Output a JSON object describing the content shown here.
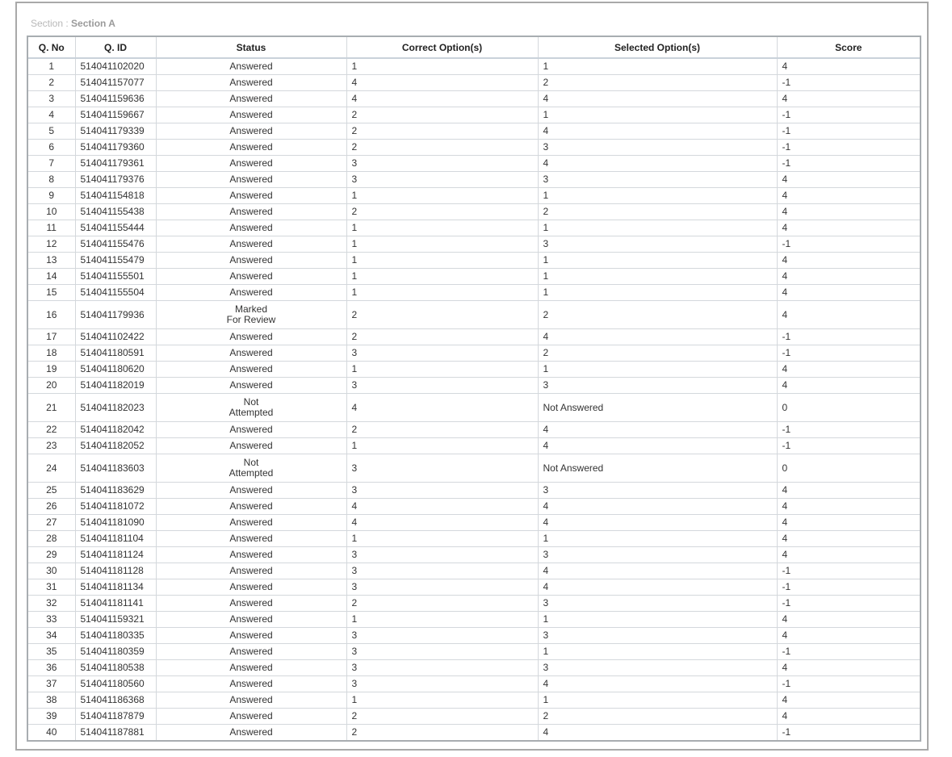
{
  "section": {
    "prefix": "Section : ",
    "name": "Section A"
  },
  "columns": [
    "Q. No",
    "Q. ID",
    "Status",
    "Correct Option(s)",
    "Selected Option(s)",
    "Score"
  ],
  "rows": [
    {
      "no": "1",
      "id": "514041102020",
      "status": [
        "Answered"
      ],
      "correct": "1",
      "selected": "1",
      "score": "4"
    },
    {
      "no": "2",
      "id": "514041157077",
      "status": [
        "Answered"
      ],
      "correct": "4",
      "selected": "2",
      "score": "-1"
    },
    {
      "no": "3",
      "id": "514041159636",
      "status": [
        "Answered"
      ],
      "correct": "4",
      "selected": "4",
      "score": "4"
    },
    {
      "no": "4",
      "id": "514041159667",
      "status": [
        "Answered"
      ],
      "correct": "2",
      "selected": "1",
      "score": "-1"
    },
    {
      "no": "5",
      "id": "514041179339",
      "status": [
        "Answered"
      ],
      "correct": "2",
      "selected": "4",
      "score": "-1"
    },
    {
      "no": "6",
      "id": "514041179360",
      "status": [
        "Answered"
      ],
      "correct": "2",
      "selected": "3",
      "score": "-1"
    },
    {
      "no": "7",
      "id": "514041179361",
      "status": [
        "Answered"
      ],
      "correct": "3",
      "selected": "4",
      "score": "-1"
    },
    {
      "no": "8",
      "id": "514041179376",
      "status": [
        "Answered"
      ],
      "correct": "3",
      "selected": "3",
      "score": "4"
    },
    {
      "no": "9",
      "id": "514041154818",
      "status": [
        "Answered"
      ],
      "correct": "1",
      "selected": "1",
      "score": "4"
    },
    {
      "no": "10",
      "id": "514041155438",
      "status": [
        "Answered"
      ],
      "correct": "2",
      "selected": "2",
      "score": "4"
    },
    {
      "no": "11",
      "id": "514041155444",
      "status": [
        "Answered"
      ],
      "correct": "1",
      "selected": "1",
      "score": "4"
    },
    {
      "no": "12",
      "id": "514041155476",
      "status": [
        "Answered"
      ],
      "correct": "1",
      "selected": "3",
      "score": "-1"
    },
    {
      "no": "13",
      "id": "514041155479",
      "status": [
        "Answered"
      ],
      "correct": "1",
      "selected": "1",
      "score": "4"
    },
    {
      "no": "14",
      "id": "514041155501",
      "status": [
        "Answered"
      ],
      "correct": "1",
      "selected": "1",
      "score": "4"
    },
    {
      "no": "15",
      "id": "514041155504",
      "status": [
        "Answered"
      ],
      "correct": "1",
      "selected": "1",
      "score": "4"
    },
    {
      "no": "16",
      "id": "514041179936",
      "status": [
        "Marked",
        "For Review"
      ],
      "correct": "2",
      "selected": "2",
      "score": "4"
    },
    {
      "no": "17",
      "id": "514041102422",
      "status": [
        "Answered"
      ],
      "correct": "2",
      "selected": "4",
      "score": "-1"
    },
    {
      "no": "18",
      "id": "514041180591",
      "status": [
        "Answered"
      ],
      "correct": "3",
      "selected": "2",
      "score": "-1"
    },
    {
      "no": "19",
      "id": "514041180620",
      "status": [
        "Answered"
      ],
      "correct": "1",
      "selected": "1",
      "score": "4"
    },
    {
      "no": "20",
      "id": "514041182019",
      "status": [
        "Answered"
      ],
      "correct": "3",
      "selected": "3",
      "score": "4"
    },
    {
      "no": "21",
      "id": "514041182023",
      "status": [
        "Not",
        "Attempted"
      ],
      "correct": "4",
      "selected": "Not Answered",
      "score": "0"
    },
    {
      "no": "22",
      "id": "514041182042",
      "status": [
        "Answered"
      ],
      "correct": "2",
      "selected": "4",
      "score": "-1"
    },
    {
      "no": "23",
      "id": "514041182052",
      "status": [
        "Answered"
      ],
      "correct": "1",
      "selected": "4",
      "score": "-1"
    },
    {
      "no": "24",
      "id": "514041183603",
      "status": [
        "Not",
        "Attempted"
      ],
      "correct": "3",
      "selected": "Not Answered",
      "score": "0"
    },
    {
      "no": "25",
      "id": "514041183629",
      "status": [
        "Answered"
      ],
      "correct": "3",
      "selected": "3",
      "score": "4"
    },
    {
      "no": "26",
      "id": "514041181072",
      "status": [
        "Answered"
      ],
      "correct": "4",
      "selected": "4",
      "score": "4"
    },
    {
      "no": "27",
      "id": "514041181090",
      "status": [
        "Answered"
      ],
      "correct": "4",
      "selected": "4",
      "score": "4"
    },
    {
      "no": "28",
      "id": "514041181104",
      "status": [
        "Answered"
      ],
      "correct": "1",
      "selected": "1",
      "score": "4"
    },
    {
      "no": "29",
      "id": "514041181124",
      "status": [
        "Answered"
      ],
      "correct": "3",
      "selected": "3",
      "score": "4"
    },
    {
      "no": "30",
      "id": "514041181128",
      "status": [
        "Answered"
      ],
      "correct": "3",
      "selected": "4",
      "score": "-1"
    },
    {
      "no": "31",
      "id": "514041181134",
      "status": [
        "Answered"
      ],
      "correct": "3",
      "selected": "4",
      "score": "-1"
    },
    {
      "no": "32",
      "id": "514041181141",
      "status": [
        "Answered"
      ],
      "correct": "2",
      "selected": "3",
      "score": "-1"
    },
    {
      "no": "33",
      "id": "514041159321",
      "status": [
        "Answered"
      ],
      "correct": "1",
      "selected": "1",
      "score": "4"
    },
    {
      "no": "34",
      "id": "514041180335",
      "status": [
        "Answered"
      ],
      "correct": "3",
      "selected": "3",
      "score": "4"
    },
    {
      "no": "35",
      "id": "514041180359",
      "status": [
        "Answered"
      ],
      "correct": "3",
      "selected": "1",
      "score": "-1"
    },
    {
      "no": "36",
      "id": "514041180538",
      "status": [
        "Answered"
      ],
      "correct": "3",
      "selected": "3",
      "score": "4"
    },
    {
      "no": "37",
      "id": "514041180560",
      "status": [
        "Answered"
      ],
      "correct": "3",
      "selected": "4",
      "score": "-1"
    },
    {
      "no": "38",
      "id": "514041186368",
      "status": [
        "Answered"
      ],
      "correct": "1",
      "selected": "1",
      "score": "4"
    },
    {
      "no": "39",
      "id": "514041187879",
      "status": [
        "Answered"
      ],
      "correct": "2",
      "selected": "2",
      "score": "4"
    },
    {
      "no": "40",
      "id": "514041187881",
      "status": [
        "Answered"
      ],
      "correct": "2",
      "selected": "4",
      "score": "-1"
    }
  ]
}
